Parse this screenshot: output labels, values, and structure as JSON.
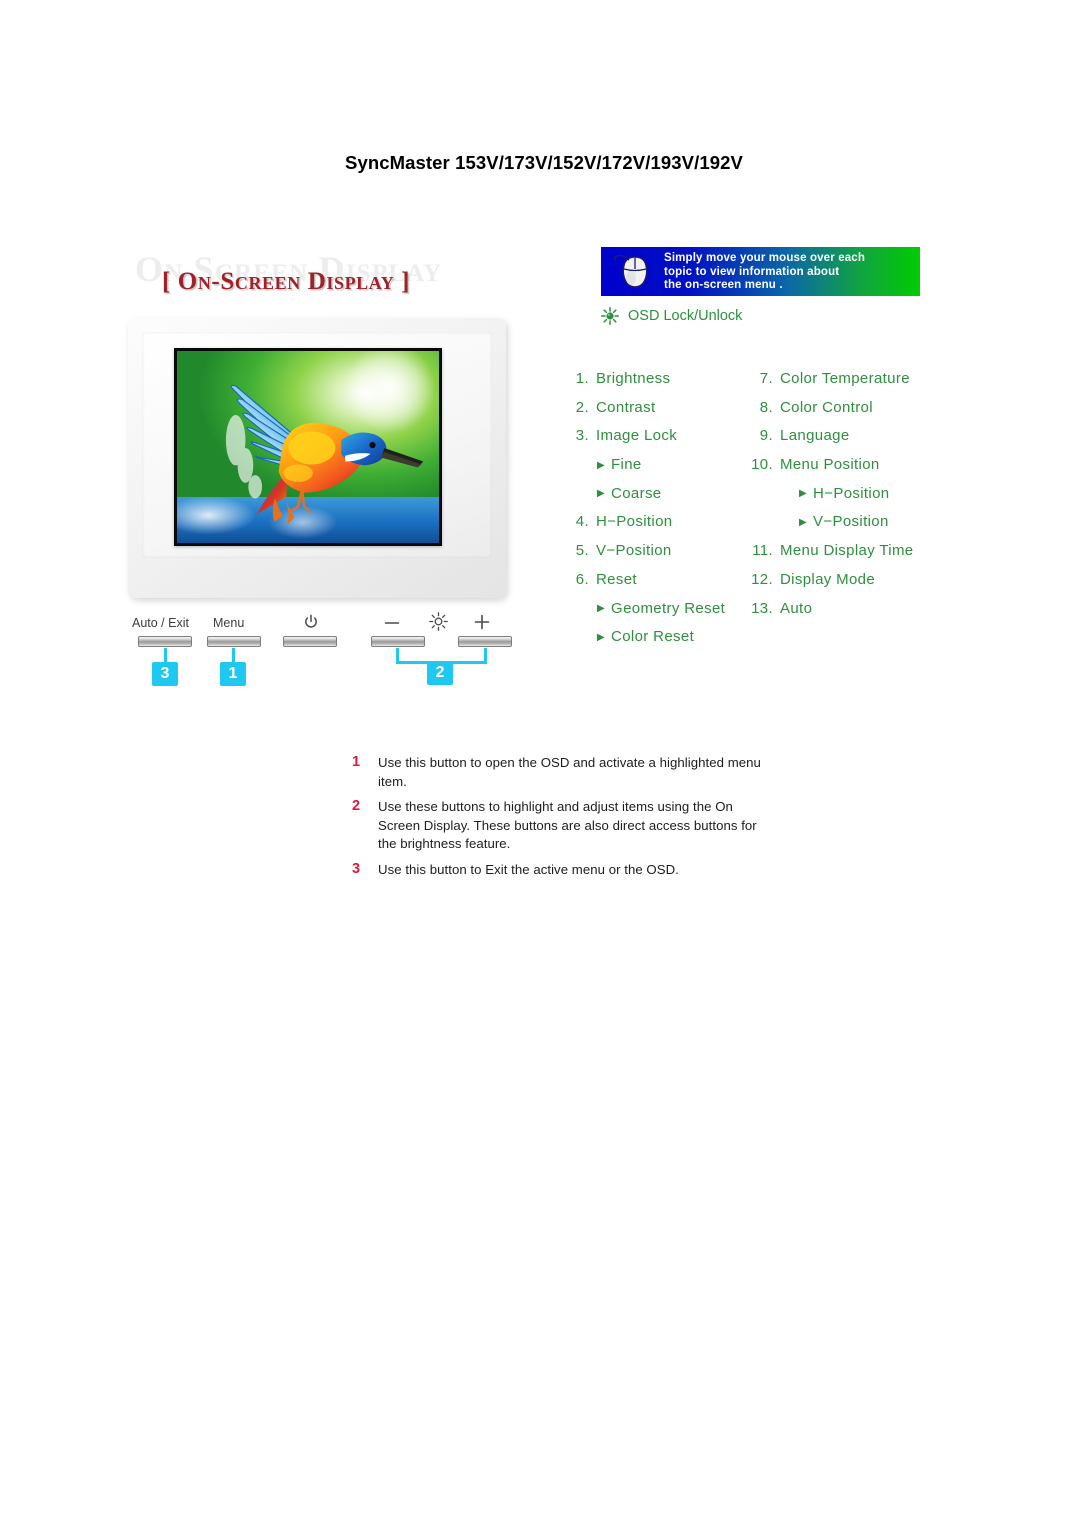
{
  "page": {
    "model_title": "SyncMaster 153V/173V/152V/172V/193V/192V"
  },
  "osd_heading": {
    "watermark": "On Screen Display",
    "title": "[ On-Screen Display ]"
  },
  "tip_banner": {
    "icon": "mouse-icon",
    "line1": "Simply move your mouse over each",
    "line2": "topic to view information about",
    "line3": "the on-screen menu ."
  },
  "osd_lock": {
    "icon": "sun-starburst-icon",
    "label": "OSD Lock/Unlock"
  },
  "menu": {
    "left_column": [
      {
        "num": "1.",
        "label": "Brightness",
        "sub": false
      },
      {
        "num": "2.",
        "label": "Contrast",
        "sub": false
      },
      {
        "num": "3.",
        "label": "Image Lock",
        "sub": false
      },
      {
        "num": "",
        "label": "Fine",
        "sub": true
      },
      {
        "num": "",
        "label": "Coarse",
        "sub": true
      },
      {
        "num": "4.",
        "label": "H−Position",
        "sub": false
      },
      {
        "num": "5.",
        "label": "V−Position",
        "sub": false
      },
      {
        "num": "6.",
        "label": "Reset",
        "sub": false
      },
      {
        "num": "",
        "label": "Geometry Reset",
        "sub": true
      },
      {
        "num": "",
        "label": "Color Reset",
        "sub": true
      }
    ],
    "right_column": [
      {
        "num": "7.",
        "label": "Color Temperature",
        "sub": false
      },
      {
        "num": "8.",
        "label": "Color Control",
        "sub": false
      },
      {
        "num": "9.",
        "label": "Language",
        "sub": false
      },
      {
        "num": "10.",
        "label": "Menu Position",
        "sub": false
      },
      {
        "num": "",
        "label": "H−Position",
        "sub": true
      },
      {
        "num": "",
        "label": "V−Position",
        "sub": true
      },
      {
        "num": "11.",
        "label": "Menu Display Time",
        "sub": false
      },
      {
        "num": "12.",
        "label": "Display Mode",
        "sub": false
      },
      {
        "num": "13.",
        "label": "Auto",
        "sub": false
      }
    ]
  },
  "controls": {
    "buttons": [
      {
        "label": "Auto / Exit",
        "icon": ""
      },
      {
        "label": "Menu",
        "icon": ""
      },
      {
        "label": "",
        "icon": "power-icon"
      },
      {
        "label": "",
        "icon": "minus-icon"
      },
      {
        "label": "",
        "icon": "plus-icon"
      }
    ],
    "brightness_icon": "brightness-sun-icon",
    "callouts": [
      {
        "number": "3",
        "target": "Auto / Exit"
      },
      {
        "number": "1",
        "target": "Menu"
      },
      {
        "number": "2",
        "target": "minus and plus"
      }
    ]
  },
  "legend": [
    {
      "num": "1",
      "text": "Use this button to open the OSD and activate a highlighted menu item."
    },
    {
      "num": "2",
      "text": "Use these buttons to highlight and adjust items using the On Screen Display. These buttons are also direct access buttons for the brightness feature."
    },
    {
      "num": "3",
      "text": "Use this button to Exit the active menu or the OSD."
    }
  ],
  "colors": {
    "menu_green": "#2f8f3e",
    "title_red": "#9e2228",
    "callout_cyan": "#1fc8f0",
    "legend_number_red": "#e01a3f",
    "banner_start": "#0000cc",
    "banner_end": "#00cc00"
  }
}
